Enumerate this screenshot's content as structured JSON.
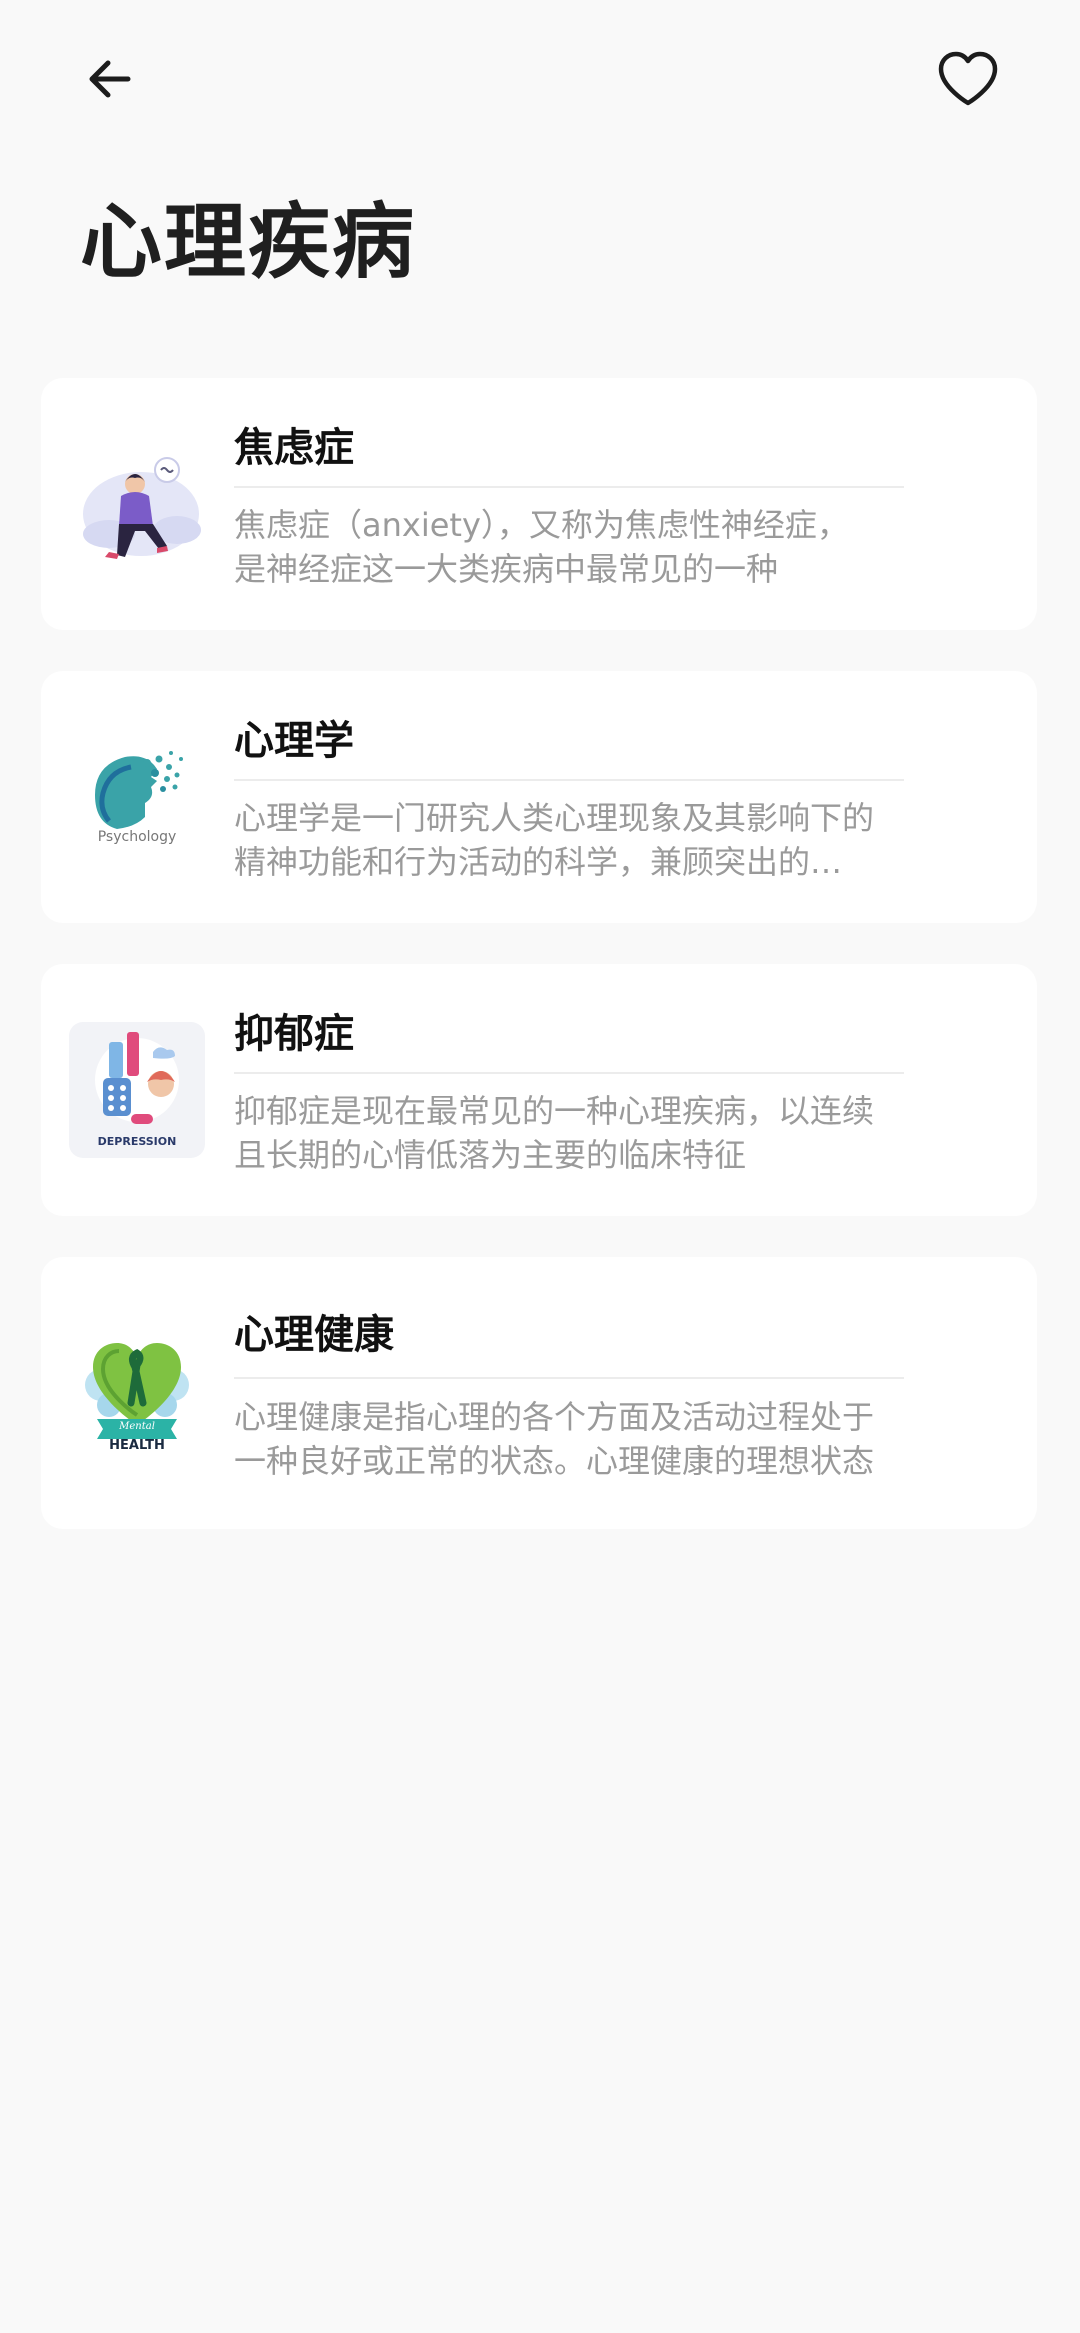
{
  "header": {
    "back_icon": "arrow-left-icon",
    "favorite_icon": "heart-outline-icon"
  },
  "page": {
    "title": "心理疾病"
  },
  "items": [
    {
      "title": "焦虑症",
      "description": "焦虑症（anxiety），又称为焦虑性神经症，是神经症这一大类疾病中最常见的一种",
      "thumbnail_icon": "anxious-person-illustration-icon"
    },
    {
      "title": "心理学",
      "description": "心理学是一门研究人类心理现象及其影响下的精神功能和行为活动的科学，兼顾突出的理论性和应用性",
      "thumbnail_icon": "psychology-head-logo-icon",
      "thumbnail_text": "Psychology"
    },
    {
      "title": "抑郁症",
      "description": "抑郁症是现在最常见的一种心理疾病，以连续且长期的心情低落为主要的临床特征",
      "thumbnail_icon": "depression-illustration-icon",
      "thumbnail_text": "DEPRESSION"
    },
    {
      "title": "心理健康",
      "description": "心理健康是指心理的各个方面及活动过程处于一种良好或正常的状态。心理健康的理想状态",
      "thumbnail_icon": "mental-health-ribbon-icon",
      "thumbnail_text_1": "Mental",
      "thumbnail_text_2": "HEALTH"
    }
  ],
  "colors": {
    "background": "#f9f9f9",
    "card": "#ffffff",
    "title": "#1f1f1f",
    "description": "#9a9a9a"
  }
}
